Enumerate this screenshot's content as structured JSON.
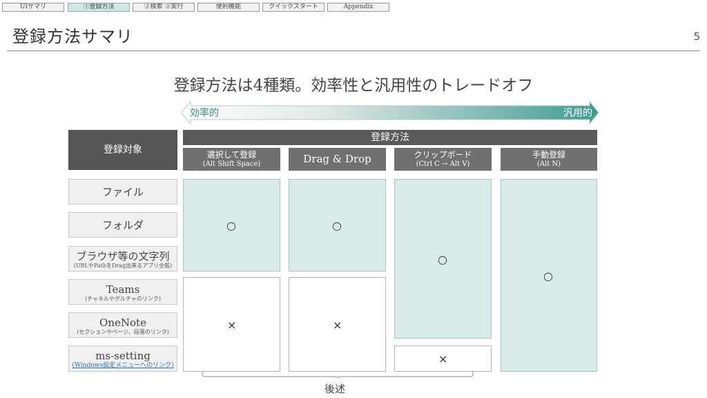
{
  "nav": {
    "tabs": [
      {
        "label": "UIサマリ",
        "active": false
      },
      {
        "label": "①登録方法",
        "active": true
      },
      {
        "label": "②検索 ③実行",
        "active": false
      },
      {
        "label": "便利機能",
        "active": false
      },
      {
        "label": "クイックスタート",
        "active": false
      },
      {
        "label": "Appendix",
        "active": false
      }
    ]
  },
  "slide": {
    "title": "登録方法サマリ",
    "page_number": "5",
    "headline": "登録方法は4種類。効率性と汎用性のトレードオフ"
  },
  "arrow": {
    "left_label": "効率的",
    "right_label": "汎用的",
    "colors": {
      "start": "#ffffff",
      "end": "#3f9a90"
    }
  },
  "table": {
    "object_header": "登録対象",
    "method_header": "登録方法",
    "methods": [
      {
        "label": "選択して登録",
        "sub": "(Alt Shift Space)"
      },
      {
        "label": "Drag & Drop",
        "sub": ""
      },
      {
        "label": "クリップボード",
        "sub": "(Ctrl C → Alt V)"
      },
      {
        "label": "手動登録",
        "sub": "(Alt N)"
      }
    ],
    "rows": [
      {
        "label": "ファイル",
        "sub": ""
      },
      {
        "label": "フォルダ",
        "sub": ""
      },
      {
        "label": "ブラウザ等の文字列",
        "sub": "(URLやPathをDrag出来るアプリ全般)"
      },
      {
        "label": "Teams",
        "sub": "(チャネルやグルチャのリンク)"
      },
      {
        "label": "OneNote",
        "sub": "(セクションやページ、段落のリンク)"
      },
      {
        "label": "ms-setting",
        "sub": "(Windows設定メニューへのリンク)"
      }
    ],
    "marks": {
      "select_top": "○",
      "select_bottom": "×",
      "dnd_top": "○",
      "dnd_bottom": "×",
      "clip_top": "○",
      "clip_bottom": "×",
      "manual": "○"
    },
    "colors": {
      "supported": "#d8ebe9",
      "unsupported": "#ffffff",
      "header": "#595959"
    }
  },
  "footnote": "後述"
}
